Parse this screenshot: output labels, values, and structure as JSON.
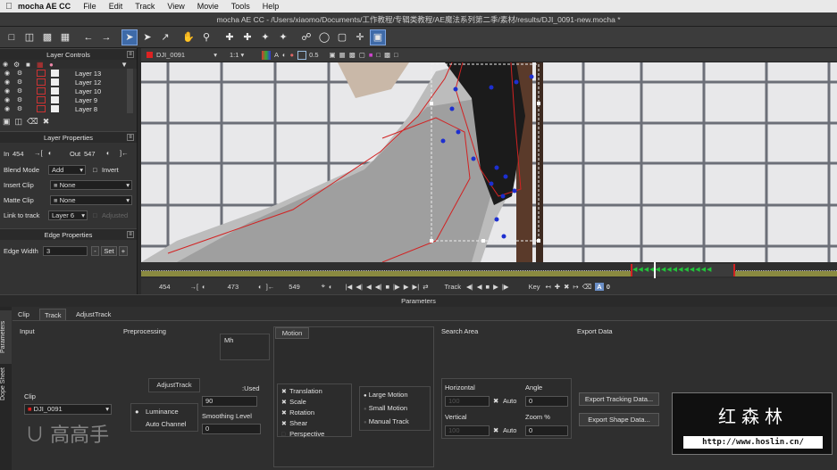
{
  "menubar": {
    "app": "mocha AE CC",
    "items": [
      "File",
      "Edit",
      "Track",
      "View",
      "Movie",
      "Tools",
      "Help"
    ]
  },
  "window_title": "mocha AE CC - /Users/xiaomo/Documents/工作教程/专辑类教程/AE魔法系列第二季/素材/results/DJI_0091-new.mocha *",
  "layer_controls": {
    "title": "Layer Controls",
    "layers": [
      "Layer 13",
      "Layer 12",
      "Layer 10",
      "Layer 9",
      "Layer 8"
    ]
  },
  "layer_properties": {
    "title": "Layer Properties",
    "in_label": "In",
    "in_value": "454",
    "out_label": "Out",
    "out_value": "547",
    "blend_mode_label": "Blend Mode",
    "blend_mode_value": "Add",
    "invert_label": "Invert",
    "insert_clip_label": "Insert Clip",
    "insert_clip_value": "None",
    "matte_clip_label": "Matte Clip",
    "matte_clip_value": "None",
    "link_to_track_label": "Link to track",
    "link_to_track_value": "Layer 6",
    "adjusted_label": "Adjusted"
  },
  "edge_properties": {
    "title": "Edge Properties",
    "edge_width_label": "Edge Width",
    "edge_width_value": "3",
    "minus": "-",
    "set_label": "Set",
    "plus": "+"
  },
  "viewer": {
    "clip_name": "DJI_0091",
    "zoom": "1:1",
    "opacity": "0.5",
    "label_a": "A"
  },
  "transport": {
    "start": "454",
    "in": "473",
    "out": "549",
    "track_label": "Track",
    "key_label": "Key"
  },
  "parameters": {
    "header": "Parameters",
    "side_tabs": [
      "Parameters",
      "Dope Sheet"
    ],
    "tabs": [
      "Clip",
      "Track",
      "AdjustTrack"
    ],
    "active_tab": "Track",
    "input_title": "Input",
    "preprocessing_title": "Preprocessing",
    "mh_label": "Mh",
    "adjust_track_label": "AdjustTrack",
    "used_label": ":Used",
    "clip_label": "Clip",
    "clip_value": "DJI_0091",
    "luminance_label": "Luminance",
    "auto_channel_label": "Auto Channel",
    "min_value": "90",
    "smoothing_label": "Smoothing Level",
    "smoothing_value": "0",
    "motion_title": "Motion",
    "motion_options": [
      "Translation",
      "Scale",
      "Rotation",
      "Shear",
      "Perspective"
    ],
    "motion_sizes": [
      "Large Motion",
      "Small Motion",
      "Manual Track"
    ],
    "search_area_title": "Search Area",
    "horizontal_label": "Horizontal",
    "vertical_label": "Vertical",
    "auto_label": "Auto",
    "h_value": "100",
    "v_value": "100",
    "angle_label": "Angle",
    "angle_value": "0",
    "zoom_label": "Zoom %",
    "zoom_value": "0",
    "export_title": "Export Data",
    "export_tracking": "Export Tracking Data...",
    "export_shape": "Export Shape Data..."
  },
  "watermark": {
    "cn": "红森林",
    "url": "http://www.hoslin.cn/",
    "logo": "高高手"
  },
  "colors": {
    "selection_blue": "#3e6aa8",
    "spline_red": "#d22222",
    "point_blue": "#1d2fd0",
    "keyframe_green": "#22c23a"
  }
}
